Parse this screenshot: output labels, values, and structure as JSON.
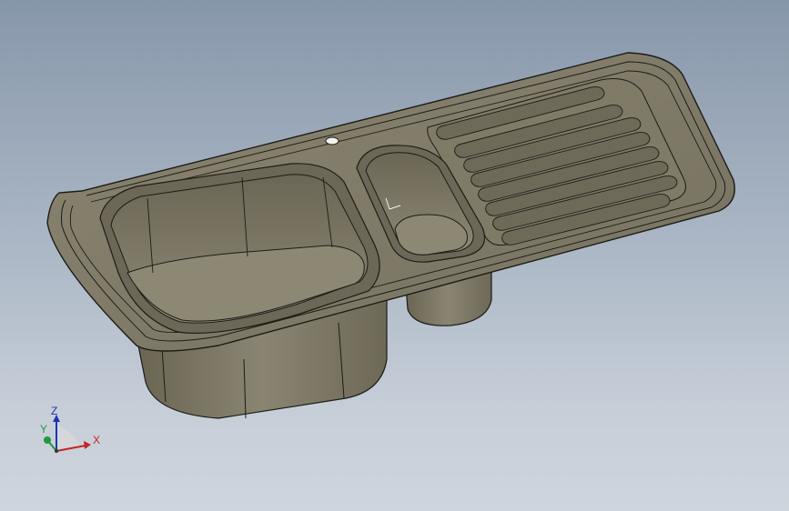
{
  "viewport": {
    "background_top": "#8797aa",
    "background_bottom": "#cfd5dd"
  },
  "model": {
    "body_color": "#7d7865",
    "edge_color": "#1c1c16",
    "shade_color": "#5e5a49",
    "highlight_color": "#9c9784"
  },
  "triad": {
    "x_label": "X",
    "y_label": "Y",
    "z_label": "Z",
    "x_color": "#c0262a",
    "y_color": "#1f9a3a",
    "z_color": "#1e34b0"
  }
}
